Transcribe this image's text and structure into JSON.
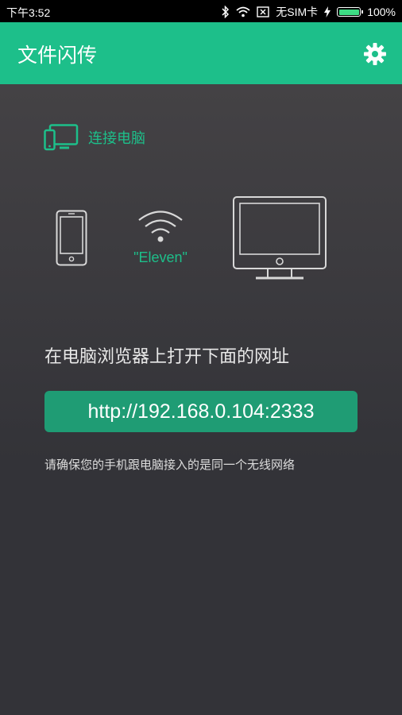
{
  "status_bar": {
    "time": "下午3:52",
    "sim": "无SIM卡",
    "battery": "100%",
    "battery_level": 1.0,
    "icons": [
      "bluetooth-icon",
      "wifi-icon",
      "sim-icon",
      "charging-icon",
      "battery-icon"
    ]
  },
  "app_bar": {
    "title": "文件闪传",
    "settings_icon": "gear-icon",
    "color": "#1dbf8a"
  },
  "main": {
    "connect_label": "连接电脑",
    "network_name": "\"Eleven\"",
    "instruction": "在电脑浏览器上打开下面的网址",
    "url": "http://192.168.0.104:2333",
    "note": "请确保您的手机跟电脑接入的是同一个无线网络",
    "accent_color": "#1dbf8a",
    "button_color": "#1f9c74"
  }
}
